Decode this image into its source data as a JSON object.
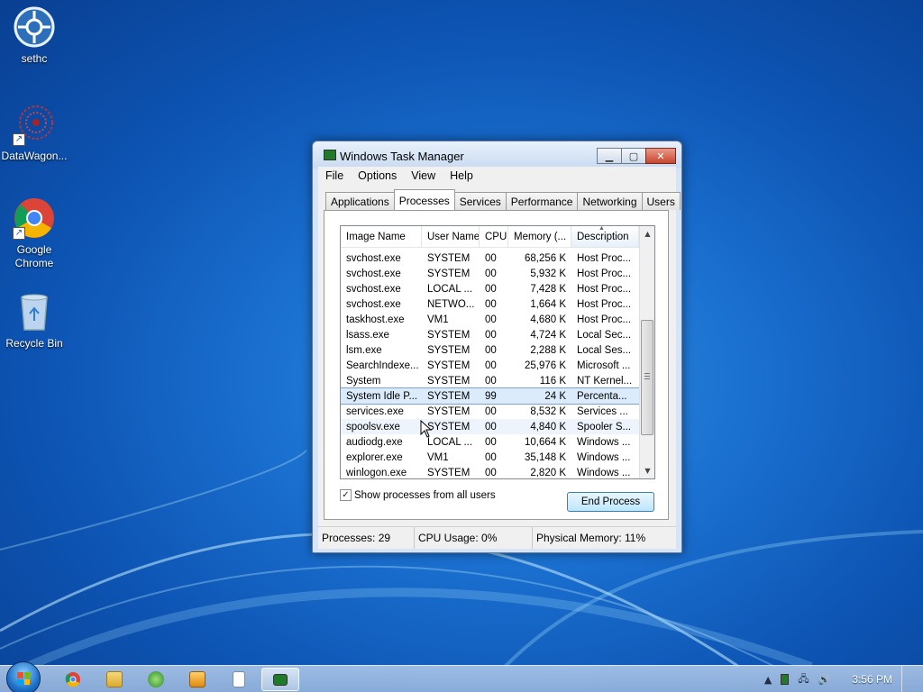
{
  "desktop": {
    "icons": [
      {
        "label": "sethc"
      },
      {
        "label": "DataWagon..."
      },
      {
        "label": "Google Chrome"
      },
      {
        "label": "Recycle Bin"
      }
    ]
  },
  "window": {
    "title": "Windows Task Manager",
    "menu": [
      "File",
      "Options",
      "View",
      "Help"
    ],
    "tabs": [
      "Applications",
      "Processes",
      "Services",
      "Performance",
      "Networking",
      "Users"
    ],
    "active_tab": "Processes",
    "columns": [
      "Image Name",
      "User Name",
      "CPU",
      "Memory (...",
      "Description"
    ],
    "sorted_column": "Description",
    "rows": [
      {
        "image": "svchost.exe",
        "user": "SYSTEM",
        "cpu": "00",
        "mem": "68,256 K",
        "desc": "Host Proc..."
      },
      {
        "image": "svchost.exe",
        "user": "SYSTEM",
        "cpu": "00",
        "mem": "5,932 K",
        "desc": "Host Proc..."
      },
      {
        "image": "svchost.exe",
        "user": "LOCAL ...",
        "cpu": "00",
        "mem": "7,428 K",
        "desc": "Host Proc..."
      },
      {
        "image": "svchost.exe",
        "user": "NETWO...",
        "cpu": "00",
        "mem": "1,664 K",
        "desc": "Host Proc..."
      },
      {
        "image": "taskhost.exe",
        "user": "VM1",
        "cpu": "00",
        "mem": "4,680 K",
        "desc": "Host Proc..."
      },
      {
        "image": "lsass.exe",
        "user": "SYSTEM",
        "cpu": "00",
        "mem": "4,724 K",
        "desc": "Local Sec..."
      },
      {
        "image": "lsm.exe",
        "user": "SYSTEM",
        "cpu": "00",
        "mem": "2,288 K",
        "desc": "Local Ses..."
      },
      {
        "image": "SearchIndexe...",
        "user": "SYSTEM",
        "cpu": "00",
        "mem": "25,976 K",
        "desc": "Microsoft ..."
      },
      {
        "image": "System",
        "user": "SYSTEM",
        "cpu": "00",
        "mem": "116 K",
        "desc": "NT Kernel..."
      },
      {
        "image": "System Idle P...",
        "user": "SYSTEM",
        "cpu": "99",
        "mem": "24 K",
        "desc": "Percenta..."
      },
      {
        "image": "services.exe",
        "user": "SYSTEM",
        "cpu": "00",
        "mem": "8,532 K",
        "desc": "Services ..."
      },
      {
        "image": "spoolsv.exe",
        "user": "SYSTEM",
        "cpu": "00",
        "mem": "4,840 K",
        "desc": "Spooler S..."
      },
      {
        "image": "audiodg.exe",
        "user": "LOCAL ...",
        "cpu": "00",
        "mem": "10,664 K",
        "desc": "Windows ..."
      },
      {
        "image": "explorer.exe",
        "user": "VM1",
        "cpu": "00",
        "mem": "35,148 K",
        "desc": "Windows ..."
      },
      {
        "image": "winlogon.exe",
        "user": "SYSTEM",
        "cpu": "00",
        "mem": "2,820 K",
        "desc": "Windows ..."
      }
    ],
    "selected_row": 9,
    "hover_row": 11,
    "show_all_label": "Show processes from all users",
    "show_all_checked": true,
    "end_process_label": "End Process",
    "status": {
      "processes": "Processes: 29",
      "cpu": "CPU Usage: 0%",
      "memory": "Physical Memory: 11%"
    }
  },
  "taskbar": {
    "clock": "3:56 PM",
    "buttons": [
      "chrome-icon",
      "explorer-icon",
      "media-center-icon",
      "media-player-icon",
      "notepad-icon",
      "task-manager-icon"
    ],
    "active_button": "task-manager-icon"
  }
}
